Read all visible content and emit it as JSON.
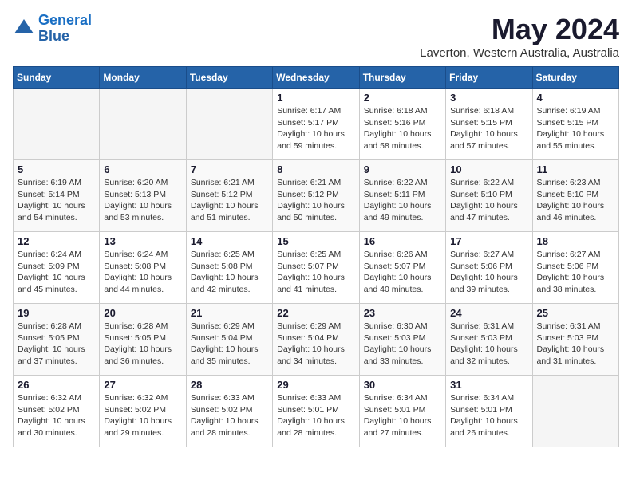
{
  "logo": {
    "line1": "General",
    "line2": "Blue"
  },
  "title": "May 2024",
  "subtitle": "Laverton, Western Australia, Australia",
  "weekdays": [
    "Sunday",
    "Monday",
    "Tuesday",
    "Wednesday",
    "Thursday",
    "Friday",
    "Saturday"
  ],
  "weeks": [
    [
      {
        "day": "",
        "info": ""
      },
      {
        "day": "",
        "info": ""
      },
      {
        "day": "",
        "info": ""
      },
      {
        "day": "1",
        "info": "Sunrise: 6:17 AM\nSunset: 5:17 PM\nDaylight: 10 hours\nand 59 minutes."
      },
      {
        "day": "2",
        "info": "Sunrise: 6:18 AM\nSunset: 5:16 PM\nDaylight: 10 hours\nand 58 minutes."
      },
      {
        "day": "3",
        "info": "Sunrise: 6:18 AM\nSunset: 5:15 PM\nDaylight: 10 hours\nand 57 minutes."
      },
      {
        "day": "4",
        "info": "Sunrise: 6:19 AM\nSunset: 5:15 PM\nDaylight: 10 hours\nand 55 minutes."
      }
    ],
    [
      {
        "day": "5",
        "info": "Sunrise: 6:19 AM\nSunset: 5:14 PM\nDaylight: 10 hours\nand 54 minutes."
      },
      {
        "day": "6",
        "info": "Sunrise: 6:20 AM\nSunset: 5:13 PM\nDaylight: 10 hours\nand 53 minutes."
      },
      {
        "day": "7",
        "info": "Sunrise: 6:21 AM\nSunset: 5:12 PM\nDaylight: 10 hours\nand 51 minutes."
      },
      {
        "day": "8",
        "info": "Sunrise: 6:21 AM\nSunset: 5:12 PM\nDaylight: 10 hours\nand 50 minutes."
      },
      {
        "day": "9",
        "info": "Sunrise: 6:22 AM\nSunset: 5:11 PM\nDaylight: 10 hours\nand 49 minutes."
      },
      {
        "day": "10",
        "info": "Sunrise: 6:22 AM\nSunset: 5:10 PM\nDaylight: 10 hours\nand 47 minutes."
      },
      {
        "day": "11",
        "info": "Sunrise: 6:23 AM\nSunset: 5:10 PM\nDaylight: 10 hours\nand 46 minutes."
      }
    ],
    [
      {
        "day": "12",
        "info": "Sunrise: 6:24 AM\nSunset: 5:09 PM\nDaylight: 10 hours\nand 45 minutes."
      },
      {
        "day": "13",
        "info": "Sunrise: 6:24 AM\nSunset: 5:08 PM\nDaylight: 10 hours\nand 44 minutes."
      },
      {
        "day": "14",
        "info": "Sunrise: 6:25 AM\nSunset: 5:08 PM\nDaylight: 10 hours\nand 42 minutes."
      },
      {
        "day": "15",
        "info": "Sunrise: 6:25 AM\nSunset: 5:07 PM\nDaylight: 10 hours\nand 41 minutes."
      },
      {
        "day": "16",
        "info": "Sunrise: 6:26 AM\nSunset: 5:07 PM\nDaylight: 10 hours\nand 40 minutes."
      },
      {
        "day": "17",
        "info": "Sunrise: 6:27 AM\nSunset: 5:06 PM\nDaylight: 10 hours\nand 39 minutes."
      },
      {
        "day": "18",
        "info": "Sunrise: 6:27 AM\nSunset: 5:06 PM\nDaylight: 10 hours\nand 38 minutes."
      }
    ],
    [
      {
        "day": "19",
        "info": "Sunrise: 6:28 AM\nSunset: 5:05 PM\nDaylight: 10 hours\nand 37 minutes."
      },
      {
        "day": "20",
        "info": "Sunrise: 6:28 AM\nSunset: 5:05 PM\nDaylight: 10 hours\nand 36 minutes."
      },
      {
        "day": "21",
        "info": "Sunrise: 6:29 AM\nSunset: 5:04 PM\nDaylight: 10 hours\nand 35 minutes."
      },
      {
        "day": "22",
        "info": "Sunrise: 6:29 AM\nSunset: 5:04 PM\nDaylight: 10 hours\nand 34 minutes."
      },
      {
        "day": "23",
        "info": "Sunrise: 6:30 AM\nSunset: 5:03 PM\nDaylight: 10 hours\nand 33 minutes."
      },
      {
        "day": "24",
        "info": "Sunrise: 6:31 AM\nSunset: 5:03 PM\nDaylight: 10 hours\nand 32 minutes."
      },
      {
        "day": "25",
        "info": "Sunrise: 6:31 AM\nSunset: 5:03 PM\nDaylight: 10 hours\nand 31 minutes."
      }
    ],
    [
      {
        "day": "26",
        "info": "Sunrise: 6:32 AM\nSunset: 5:02 PM\nDaylight: 10 hours\nand 30 minutes."
      },
      {
        "day": "27",
        "info": "Sunrise: 6:32 AM\nSunset: 5:02 PM\nDaylight: 10 hours\nand 29 minutes."
      },
      {
        "day": "28",
        "info": "Sunrise: 6:33 AM\nSunset: 5:02 PM\nDaylight: 10 hours\nand 28 minutes."
      },
      {
        "day": "29",
        "info": "Sunrise: 6:33 AM\nSunset: 5:01 PM\nDaylight: 10 hours\nand 28 minutes."
      },
      {
        "day": "30",
        "info": "Sunrise: 6:34 AM\nSunset: 5:01 PM\nDaylight: 10 hours\nand 27 minutes."
      },
      {
        "day": "31",
        "info": "Sunrise: 6:34 AM\nSunset: 5:01 PM\nDaylight: 10 hours\nand 26 minutes."
      },
      {
        "day": "",
        "info": ""
      }
    ]
  ]
}
